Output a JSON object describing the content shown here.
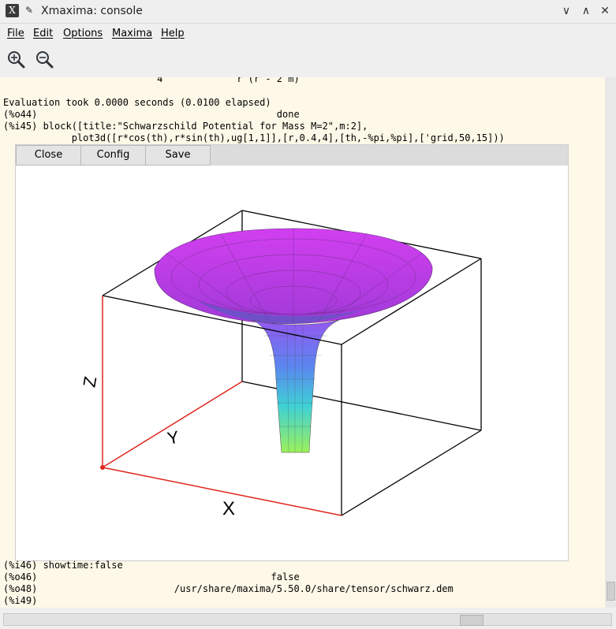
{
  "window": {
    "title": "Xmaxima: console",
    "app_icon": "X",
    "controls": {
      "minimize": "∨",
      "maximize": "∧",
      "close": "✕"
    }
  },
  "menu": {
    "items": [
      "File",
      "Edit",
      "Options",
      "Maxima",
      "Help"
    ]
  },
  "toolbar": {
    "icons": [
      "zoom-in-icon",
      "zoom-out-icon"
    ]
  },
  "console": {
    "lines_top": [
      "                           4             r (r - 2 m)",
      "",
      "Evaluation took 0.0000 seconds (0.0100 elapsed)",
      "(%o44)                                          done",
      "(%i45) block([title:\"Schwarzschild Potential for Mass M=2\",m:2],",
      "            plot3d([r*cos(th),r*sin(th),ug[1,1]],[r,0.4,4],[th,-%pi,%pi],['grid,50,15]))"
    ],
    "lines_bottom": [
      "(%i46) showtime:false",
      "(%o46)                                         false",
      "(%o48)                        /usr/share/maxima/5.50.0/share/tensor/schwarz.dem",
      "(%i49)"
    ]
  },
  "plot": {
    "buttons": {
      "close": "Close",
      "config": "Config",
      "save": "Save"
    },
    "axes": {
      "x": "X",
      "y": "Y",
      "z": "Z"
    }
  },
  "colors": {
    "console_bg": "#fdf8e7",
    "axis_red": "#e0241d",
    "surface_top": "#d23ff0",
    "surface_bottom": "#9cf05a"
  }
}
